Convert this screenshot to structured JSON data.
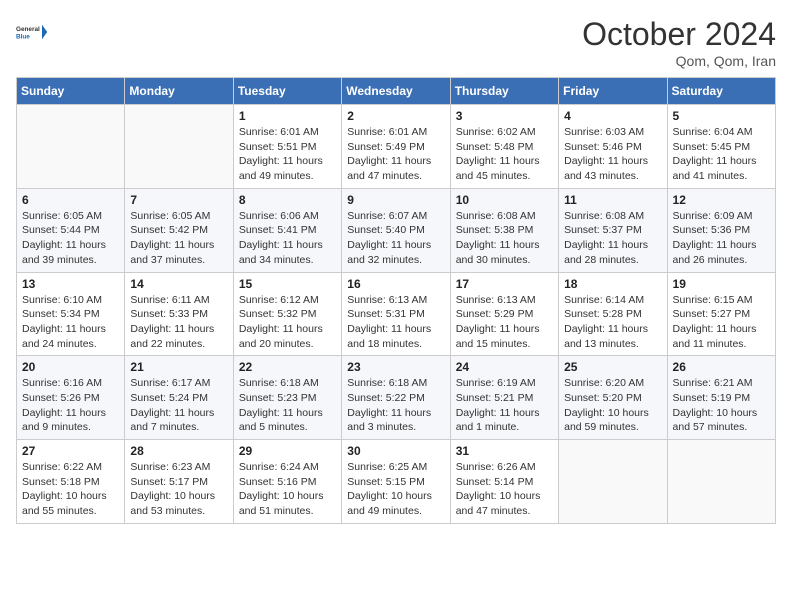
{
  "logo": {
    "general": "General",
    "blue": "Blue"
  },
  "title": "October 2024",
  "location": "Qom, Qom, Iran",
  "headers": [
    "Sunday",
    "Monday",
    "Tuesday",
    "Wednesday",
    "Thursday",
    "Friday",
    "Saturday"
  ],
  "weeks": [
    [
      {
        "day": "",
        "info": ""
      },
      {
        "day": "",
        "info": ""
      },
      {
        "day": "1",
        "info": "Sunrise: 6:01 AM\nSunset: 5:51 PM\nDaylight: 11 hours and 49 minutes."
      },
      {
        "day": "2",
        "info": "Sunrise: 6:01 AM\nSunset: 5:49 PM\nDaylight: 11 hours and 47 minutes."
      },
      {
        "day": "3",
        "info": "Sunrise: 6:02 AM\nSunset: 5:48 PM\nDaylight: 11 hours and 45 minutes."
      },
      {
        "day": "4",
        "info": "Sunrise: 6:03 AM\nSunset: 5:46 PM\nDaylight: 11 hours and 43 minutes."
      },
      {
        "day": "5",
        "info": "Sunrise: 6:04 AM\nSunset: 5:45 PM\nDaylight: 11 hours and 41 minutes."
      }
    ],
    [
      {
        "day": "6",
        "info": "Sunrise: 6:05 AM\nSunset: 5:44 PM\nDaylight: 11 hours and 39 minutes."
      },
      {
        "day": "7",
        "info": "Sunrise: 6:05 AM\nSunset: 5:42 PM\nDaylight: 11 hours and 37 minutes."
      },
      {
        "day": "8",
        "info": "Sunrise: 6:06 AM\nSunset: 5:41 PM\nDaylight: 11 hours and 34 minutes."
      },
      {
        "day": "9",
        "info": "Sunrise: 6:07 AM\nSunset: 5:40 PM\nDaylight: 11 hours and 32 minutes."
      },
      {
        "day": "10",
        "info": "Sunrise: 6:08 AM\nSunset: 5:38 PM\nDaylight: 11 hours and 30 minutes."
      },
      {
        "day": "11",
        "info": "Sunrise: 6:08 AM\nSunset: 5:37 PM\nDaylight: 11 hours and 28 minutes."
      },
      {
        "day": "12",
        "info": "Sunrise: 6:09 AM\nSunset: 5:36 PM\nDaylight: 11 hours and 26 minutes."
      }
    ],
    [
      {
        "day": "13",
        "info": "Sunrise: 6:10 AM\nSunset: 5:34 PM\nDaylight: 11 hours and 24 minutes."
      },
      {
        "day": "14",
        "info": "Sunrise: 6:11 AM\nSunset: 5:33 PM\nDaylight: 11 hours and 22 minutes."
      },
      {
        "day": "15",
        "info": "Sunrise: 6:12 AM\nSunset: 5:32 PM\nDaylight: 11 hours and 20 minutes."
      },
      {
        "day": "16",
        "info": "Sunrise: 6:13 AM\nSunset: 5:31 PM\nDaylight: 11 hours and 18 minutes."
      },
      {
        "day": "17",
        "info": "Sunrise: 6:13 AM\nSunset: 5:29 PM\nDaylight: 11 hours and 15 minutes."
      },
      {
        "day": "18",
        "info": "Sunrise: 6:14 AM\nSunset: 5:28 PM\nDaylight: 11 hours and 13 minutes."
      },
      {
        "day": "19",
        "info": "Sunrise: 6:15 AM\nSunset: 5:27 PM\nDaylight: 11 hours and 11 minutes."
      }
    ],
    [
      {
        "day": "20",
        "info": "Sunrise: 6:16 AM\nSunset: 5:26 PM\nDaylight: 11 hours and 9 minutes."
      },
      {
        "day": "21",
        "info": "Sunrise: 6:17 AM\nSunset: 5:24 PM\nDaylight: 11 hours and 7 minutes."
      },
      {
        "day": "22",
        "info": "Sunrise: 6:18 AM\nSunset: 5:23 PM\nDaylight: 11 hours and 5 minutes."
      },
      {
        "day": "23",
        "info": "Sunrise: 6:18 AM\nSunset: 5:22 PM\nDaylight: 11 hours and 3 minutes."
      },
      {
        "day": "24",
        "info": "Sunrise: 6:19 AM\nSunset: 5:21 PM\nDaylight: 11 hours and 1 minute."
      },
      {
        "day": "25",
        "info": "Sunrise: 6:20 AM\nSunset: 5:20 PM\nDaylight: 10 hours and 59 minutes."
      },
      {
        "day": "26",
        "info": "Sunrise: 6:21 AM\nSunset: 5:19 PM\nDaylight: 10 hours and 57 minutes."
      }
    ],
    [
      {
        "day": "27",
        "info": "Sunrise: 6:22 AM\nSunset: 5:18 PM\nDaylight: 10 hours and 55 minutes."
      },
      {
        "day": "28",
        "info": "Sunrise: 6:23 AM\nSunset: 5:17 PM\nDaylight: 10 hours and 53 minutes."
      },
      {
        "day": "29",
        "info": "Sunrise: 6:24 AM\nSunset: 5:16 PM\nDaylight: 10 hours and 51 minutes."
      },
      {
        "day": "30",
        "info": "Sunrise: 6:25 AM\nSunset: 5:15 PM\nDaylight: 10 hours and 49 minutes."
      },
      {
        "day": "31",
        "info": "Sunrise: 6:26 AM\nSunset: 5:14 PM\nDaylight: 10 hours and 47 minutes."
      },
      {
        "day": "",
        "info": ""
      },
      {
        "day": "",
        "info": ""
      }
    ]
  ]
}
